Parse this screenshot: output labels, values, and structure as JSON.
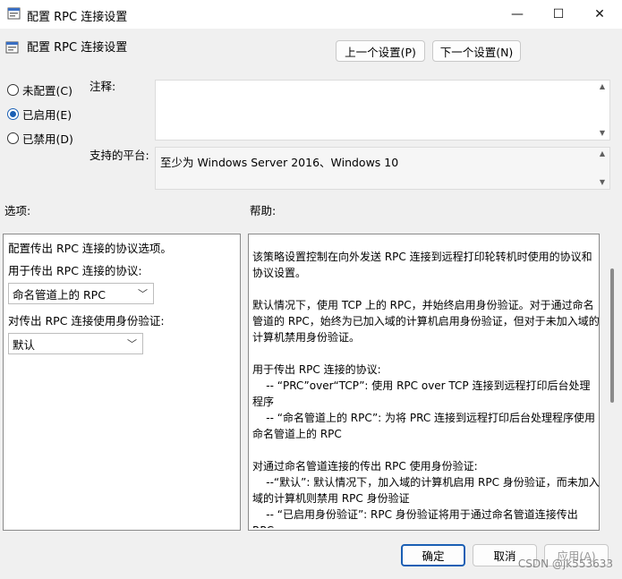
{
  "window": {
    "title": "配置 RPC 连接设置",
    "controls": {
      "minimize": "—",
      "maximize": "☐",
      "close": "✕"
    }
  },
  "header": {
    "title": "配置 RPC 连接设置",
    "prev_button": "上一个设置(P)",
    "next_button": "下一个设置(N)"
  },
  "state": {
    "options": [
      {
        "label": "未配置(C)",
        "selected": false
      },
      {
        "label": "已启用(E)",
        "selected": true
      },
      {
        "label": "已禁用(D)",
        "selected": false
      }
    ]
  },
  "comment": {
    "label": "注释:",
    "value": ""
  },
  "platform": {
    "label": "支持的平台:",
    "value": "至少为 Windows Server 2016、Windows 10"
  },
  "options_section": {
    "label": "选项:",
    "heading": "配置传出 RPC 连接的协议选项。",
    "protocol_label": "用于传出 RPC 连接的协议:",
    "protocol_value": "命名管道上的 RPC",
    "auth_label": "对传出 RPC 连接使用身份验证:",
    "auth_value": "默认"
  },
  "help_section": {
    "label": "帮助:",
    "text": "该策略设置控制在向外发送 RPC 连接到远程打印轮转机时使用的协议和协议设置。\n\n默认情况下，使用 TCP 上的 RPC，并始终启用身份验证。对于通过命名管道的 RPC，始终为已加入域的计算机启用身份验证，但对于未加入域的计算机禁用身份验证。\n\n用于传出 RPC 连接的协议:\n    -- “PRC”over“TCP”: 使用 RPC over TCP 连接到远程打印后台处理程序\n    -- “命名管道上的 RPC”: 为将 PRC 连接到远程打印后台处理程序使用命名管道上的 RPC\n\n对通过命名管道连接的传出 RPC 使用身份验证:\n    --“默认”: 默认情况下，加入域的计算机启用 RPC 身份验证，而未加入域的计算机则禁用 RPC 身份验证\n    -- “已启用身份验证”: RPC 身份验证将用于通过命名管道连接传出 RPC\n    -- “已禁用身份验证”: RPC 身份验证将不用于通过命名管道连接传出"
  },
  "footer": {
    "ok": "确定",
    "cancel": "取消",
    "apply": "应用(A)"
  },
  "watermark": "CSDN @jk553633",
  "colors": {
    "accent": "#1a5fb4",
    "background": "#f0f0f0"
  }
}
